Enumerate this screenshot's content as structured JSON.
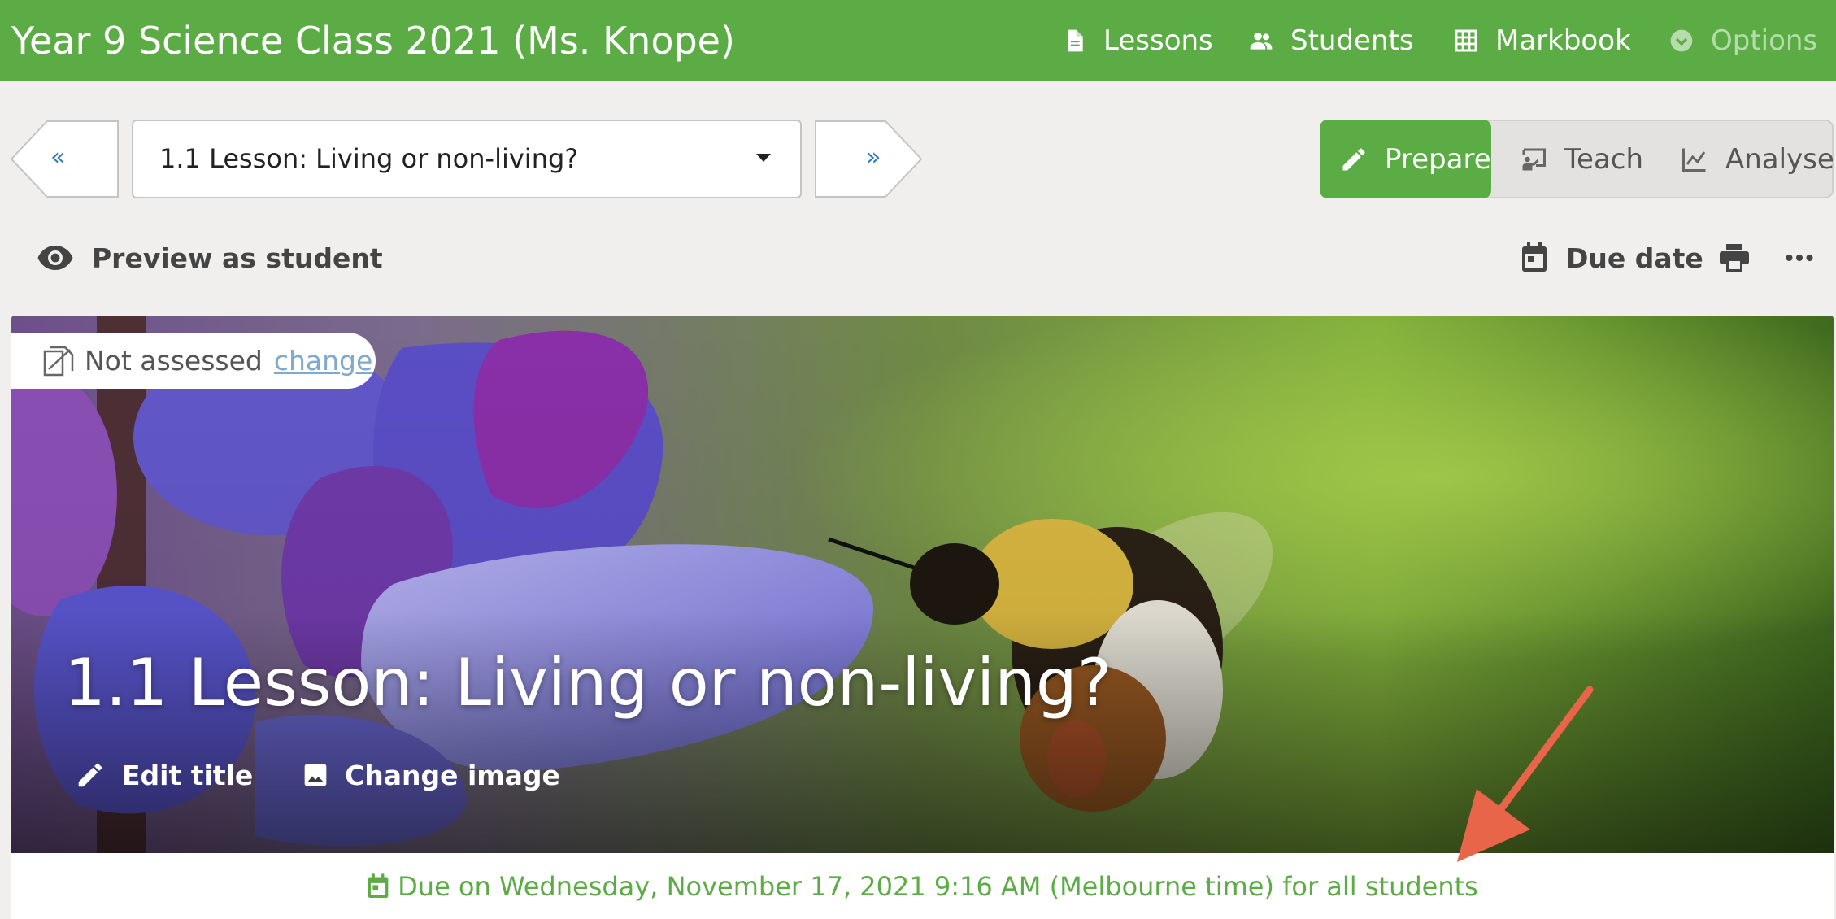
{
  "header": {
    "title": "Year 9 Science Class 2021 (Ms. Knope)",
    "nav": {
      "lessons": "Lessons",
      "students": "Students",
      "markbook": "Markbook",
      "options": "Options"
    }
  },
  "lesson_nav": {
    "prev_label": "«",
    "next_label": "»",
    "selected_lesson": "1.1 Lesson: Living or non-living?"
  },
  "modes": {
    "prepare": "Prepare",
    "teach": "Teach",
    "analyse": "Analyse",
    "active": "Prepare"
  },
  "actions": {
    "preview": "Preview as student",
    "due_date": "Due date"
  },
  "hero": {
    "assessment_status": "Not assessed",
    "change_link": "change",
    "title": "1.1 Lesson: Living or non-living?",
    "edit_title": "Edit title",
    "change_image": "Change image"
  },
  "due": {
    "text": "Due on Wednesday, November 17, 2021 9:16 AM (Melbourne time) for all students"
  },
  "colors": {
    "brand_green": "#5cac46",
    "link_blue": "#2f79bd",
    "annotation_red": "#e8654a"
  },
  "icons": [
    "document-icon",
    "people-icon",
    "grid-icon",
    "chevron-down-circle-icon",
    "pencil-icon",
    "whiteboard-icon",
    "line-chart-icon",
    "eye-icon",
    "calendar-icon",
    "print-icon",
    "more-icon",
    "assessment-icon",
    "image-icon"
  ]
}
